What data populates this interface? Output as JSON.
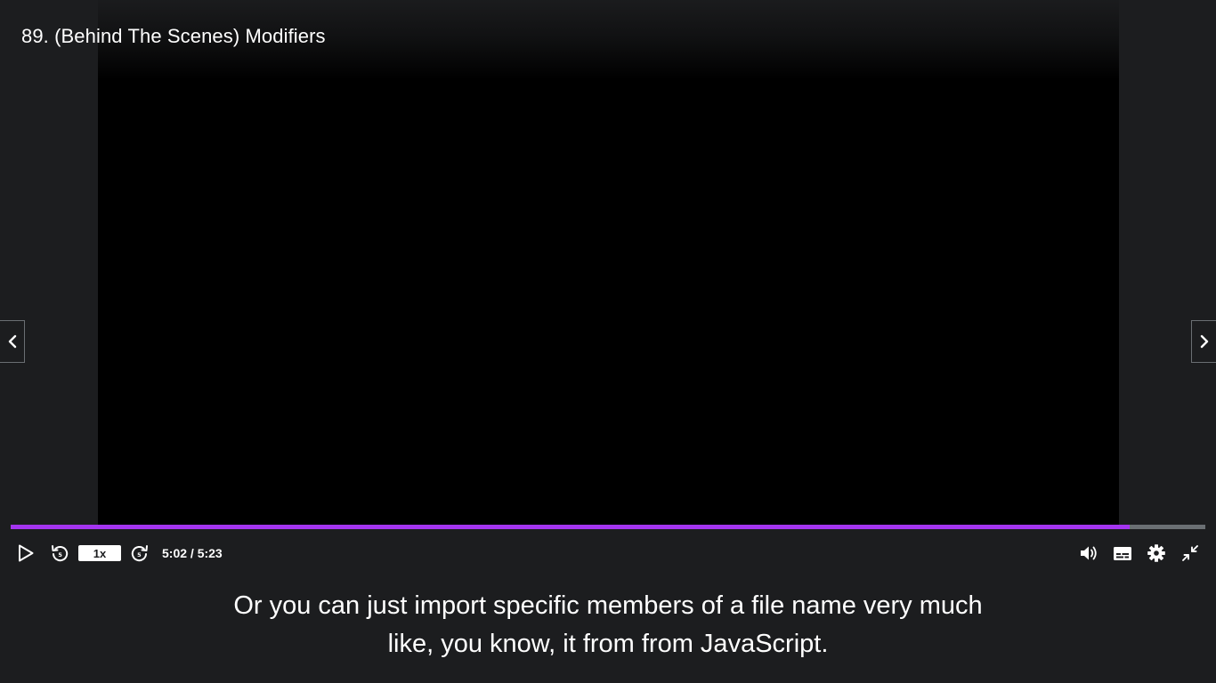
{
  "lecture": {
    "title": "89. (Behind The Scenes) Modifiers"
  },
  "player": {
    "progress_fraction": 0.937,
    "accent_color": "#a435f0",
    "speed_label": "1x",
    "time_display": "5:02 / 5:23"
  },
  "icons": {
    "play": "play-icon",
    "rewind": "rewind-5-icon",
    "forward": "forward-5-icon",
    "volume": "volume-icon",
    "captions": "captions-icon",
    "settings": "gear-icon",
    "exit_fullscreen": "exit-fullscreen-icon",
    "prev": "chevron-left-icon",
    "next": "chevron-right-icon"
  },
  "captions": {
    "lines": [
      "Or you can just import specific members of a file name very much",
      "like, you know, it from from JavaScript."
    ]
  }
}
